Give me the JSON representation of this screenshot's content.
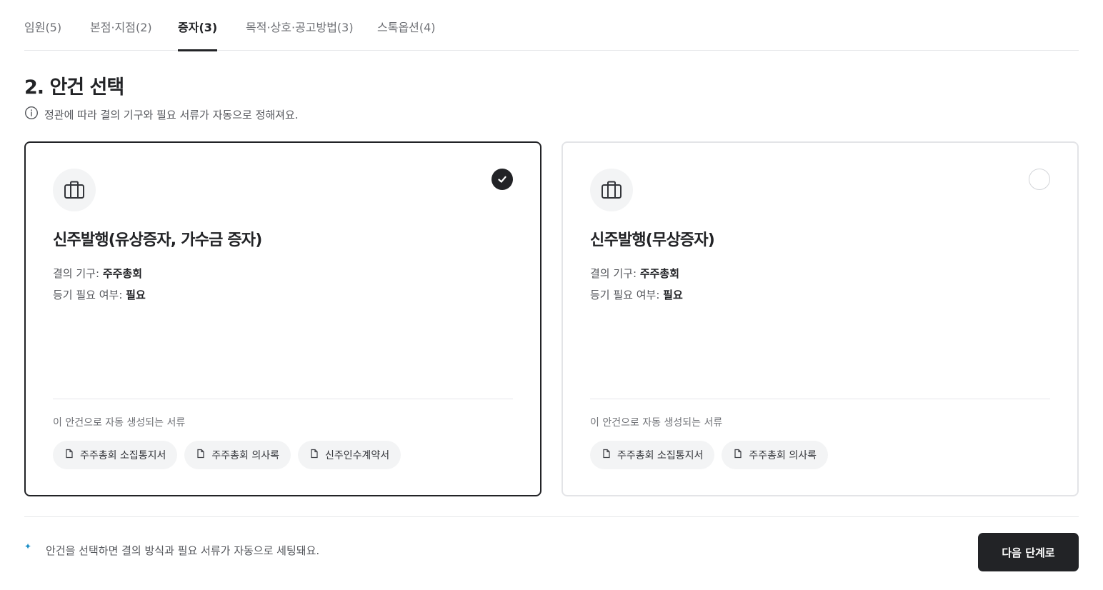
{
  "tabs": [
    {
      "label": "임원(5)",
      "active": false
    },
    {
      "label": "본점·지점(2)",
      "active": false
    },
    {
      "label": "증자(3)",
      "active": true
    },
    {
      "label": "목적·상호·공고방법(3)",
      "active": false
    },
    {
      "label": "스톡옵션(4)",
      "active": false
    }
  ],
  "section": {
    "title": "2. 안건 선택",
    "info": "정관에 따라 결의 기구와 필요 서류가 자동으로 정해져요."
  },
  "cards": [
    {
      "title": "신주발행(유상증자, 가수금 증자)",
      "selected": true,
      "resolution_label": "결의 기구:",
      "resolution_value": "주주총회",
      "registration_label": "등기 필요 여부:",
      "registration_value": "필요",
      "docs_label": "이 안건으로 자동 생성되는 서류",
      "docs": [
        "주주총회 소집통지서",
        "주주총회 의사록",
        "신주인수계약서"
      ]
    },
    {
      "title": "신주발행(무상증자)",
      "selected": false,
      "resolution_label": "결의 기구:",
      "resolution_value": "주주총회",
      "registration_label": "등기 필요 여부:",
      "registration_value": "필요",
      "docs_label": "이 안건으로 자동 생성되는 서류",
      "docs": [
        "주주총회 소집통지서",
        "주주총회 의사록"
      ]
    }
  ],
  "footer": {
    "note": "안건을 선택하면 결의 방식과 필요 서류가 자동으로 세팅돼요.",
    "next_label": "다음 단계로"
  },
  "colors": {
    "primary": "#222326",
    "muted_text": "#6f7176",
    "border": "#e3e4e7",
    "chip_bg": "#f3f4f5",
    "sparkle": "#1e8fc7"
  },
  "icons": {
    "info": "info-icon",
    "briefcase": "briefcase-icon",
    "check": "check-icon",
    "document": "document-icon",
    "sparkle": "sparkle-icon"
  }
}
